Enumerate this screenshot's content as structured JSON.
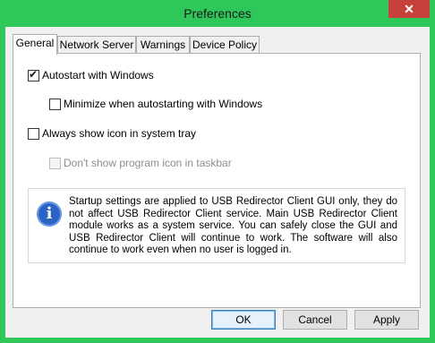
{
  "window": {
    "title": "Preferences",
    "close_glyph": "✕"
  },
  "tabs": [
    {
      "label": "General",
      "active": true
    },
    {
      "label": "Network Server",
      "active": false
    },
    {
      "label": "Warnings",
      "active": false
    },
    {
      "label": "Device Policy",
      "active": false
    }
  ],
  "options": {
    "autostart": {
      "label": "Autostart with Windows",
      "checked": true,
      "enabled": true
    },
    "minimize": {
      "label": "Minimize when autostarting with Windows",
      "checked": false,
      "enabled": true
    },
    "tray_icon": {
      "label": "Always show icon in system tray",
      "checked": false,
      "enabled": true
    },
    "hide_taskbar": {
      "label": "Don't show program icon in taskbar",
      "checked": false,
      "enabled": false
    }
  },
  "info": {
    "icon": "info-icon",
    "icon_glyph": "i",
    "text": "Startup settings are applied to USB Redirector Client GUI only, they do not affect USB Redirector Client service. Main USB Redirector Client module works as a system service. You can safely close the GUI and USB Redirector Client will continue to work. The software will also continue to work even when no user is logged in."
  },
  "buttons": {
    "ok": "OK",
    "cancel": "Cancel",
    "apply": "Apply"
  },
  "colors": {
    "titlebar": "#2fc65a",
    "close": "#c7403a",
    "info_icon": "#2a62c6"
  }
}
